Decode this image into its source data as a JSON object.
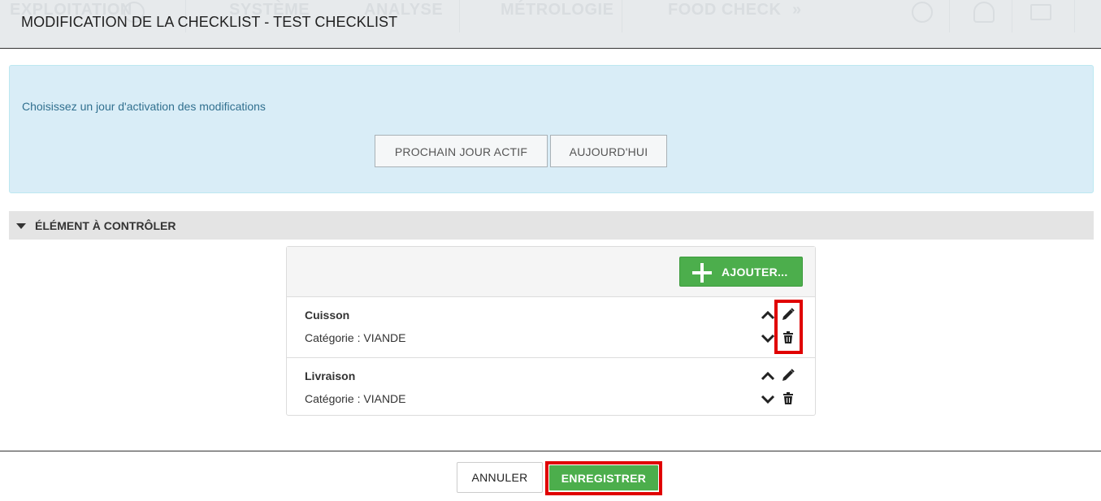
{
  "background_nav": {
    "items": [
      "EXPLOITATION",
      "SYSTÈME",
      "ANALYSE",
      "MÉTROLOGIE",
      "FOOD CHECK",
      "»"
    ]
  },
  "modal": {
    "title": "MODIFICATION DE LA CHECKLIST - TEST CHECKLIST",
    "activation": {
      "message": "Choisissez un jour d'activation des modifications",
      "next_active_day_label": "PROCHAIN JOUR ACTIF",
      "today_label": "AUJOURD'HUI"
    },
    "section": {
      "title": "ÉLÉMENT À CONTRÔLER",
      "add_label": "AJOUTER...",
      "items": [
        {
          "name": "Cuisson",
          "category": "Catégorie : VIANDE"
        },
        {
          "name": "Livraison",
          "category": "Catégorie : VIANDE"
        }
      ]
    },
    "footer": {
      "cancel_label": "ANNULER",
      "save_label": "ENREGISTRER"
    }
  },
  "colors": {
    "accent_green": "#4cae4c",
    "info_bg": "#d9edf7",
    "info_text": "#31708f",
    "highlight_red": "#e00000"
  }
}
